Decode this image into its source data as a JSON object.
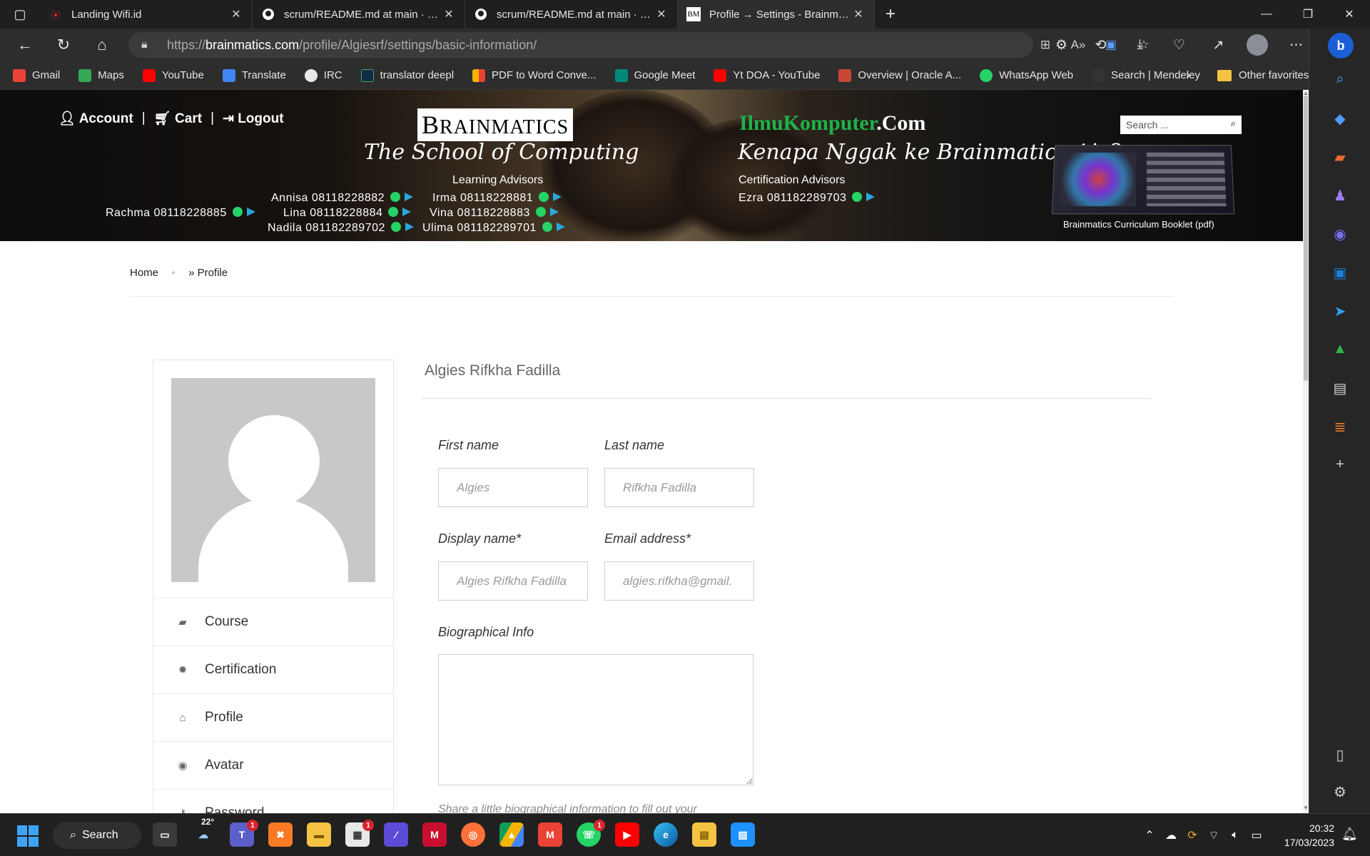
{
  "browser": {
    "tabs": [
      {
        "title": "Landing Wifi.id",
        "icon": "wifi-icon",
        "color": "#e02424"
      },
      {
        "title": "scrum/README.md at main · bukan",
        "icon": "github-icon",
        "color": "#ffffff"
      },
      {
        "title": "scrum/README.md at main · bukan",
        "icon": "github-icon",
        "color": "#ffffff"
      },
      {
        "title": "Profile → Settings - Brainmatics",
        "icon": "bm-icon",
        "color": "#ffffff",
        "active": true
      }
    ],
    "url_prefix": "https://",
    "url_domain": "brainmatics.com",
    "url_path": "/profile/Algiesrf/settings/basic-information/",
    "bookmarks": [
      {
        "label": "Gmail",
        "color": "#ea4335"
      },
      {
        "label": "Maps",
        "color": "#34a853"
      },
      {
        "label": "YouTube",
        "color": "#ff0000"
      },
      {
        "label": "Translate",
        "color": "#4285f4"
      },
      {
        "label": "IRC",
        "color": "#e8e8e8"
      },
      {
        "label": "translator deepl",
        "color": "#0f2b46"
      },
      {
        "label": "PDF to Word Conve...",
        "color": "#f4b400"
      },
      {
        "label": "Google Meet",
        "color": "#00897b"
      },
      {
        "label": "Yt DOA - YouTube",
        "color": "#ff0000"
      },
      {
        "label": "Overview | Oracle A...",
        "color": "#c74634"
      },
      {
        "label": "WhatsApp Web",
        "color": "#25d366"
      },
      {
        "label": "Search | Mendeley",
        "color": "#333333"
      }
    ],
    "other_favorites": "Other favorites"
  },
  "banner": {
    "account": "Account",
    "cart": "Cart",
    "logout": "Logout",
    "sep": "|",
    "brand_big": "B",
    "brand_rest": "RAIN",
    "brand_tail": "MATICS",
    "school": "The School of Computing",
    "ilmu_green": "IlmuKomputer",
    "ilmu_white": ".Com",
    "kenapa": "Kenapa Nggak ke Brainmatics Aja?",
    "learning_title": "Learning Advisors",
    "cert_title": "Certification Advisors",
    "contacts": {
      "rachma": "Rachma  08118228885",
      "annisa": "Annisa  08118228882",
      "lina": "Lina  08118228884",
      "nadila": "Nadila  081182289702",
      "irma": "Irma  08118228881",
      "vina": "Vina  08118228883",
      "ulima": "Ulima  081182289701",
      "ezra": "Ezra  081182289703"
    },
    "search_placeholder": "Search ...",
    "booklet_label": "Brainmatics Curriculum Booklet (pdf)"
  },
  "breadcrumb": {
    "home": "Home",
    "current": "» Profile"
  },
  "sidebar": {
    "items": [
      {
        "label": "Course",
        "icon": "book-icon"
      },
      {
        "label": "Certification",
        "icon": "certificate-icon"
      },
      {
        "label": "Profile",
        "icon": "home-icon"
      },
      {
        "label": "Avatar",
        "icon": "user-circle-icon"
      },
      {
        "label": "Password",
        "icon": "key-icon"
      }
    ]
  },
  "profile": {
    "display_name": "Algies Rifkha Fadilla",
    "first_name_label": "First name",
    "first_name_value": "Algies",
    "last_name_label": "Last name",
    "last_name_value": "Rifkha Fadilla",
    "display_name_label": "Display name*",
    "display_name_value": "Algies Rifkha Fadilla",
    "email_label": "Email address*",
    "email_value": "algies.rifkha@gmail.",
    "bio_label": "Biographical Info",
    "bio_value": "",
    "bio_hint": "Share a little biographical information to fill out your"
  },
  "taskbar": {
    "search": "Search",
    "weather": "22°",
    "teams_badge": "1",
    "store_badge": "1",
    "whatsapp_badge": "1",
    "time": "20:32",
    "date": "17/03/2023"
  }
}
